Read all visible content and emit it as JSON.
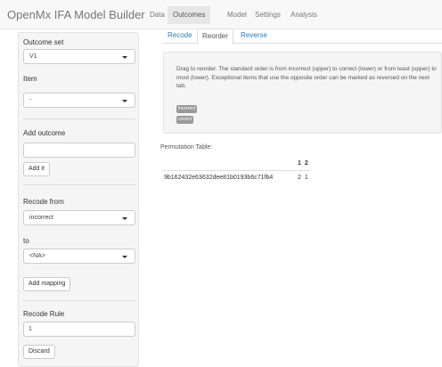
{
  "app": {
    "brand": "OpenMx IFA Model Builder"
  },
  "navbar": {
    "tabs": [
      {
        "label": "Data",
        "active": false
      },
      {
        "label": "Outcomes",
        "active": true
      },
      {
        "label": "Model",
        "active": false
      },
      {
        "label": "Settings",
        "active": false
      },
      {
        "label": "Analysis",
        "active": false
      }
    ]
  },
  "sidebar": {
    "outcome_set": {
      "label": "Outcome set",
      "value": "V1"
    },
    "item": {
      "label": "Item",
      "value": "-"
    },
    "add_outcome": {
      "label": "Add outcome",
      "value": "",
      "button": "Add it"
    },
    "recode_from": {
      "label": "Recode from",
      "value": "incorrect"
    },
    "recode_to": {
      "label": "to",
      "value": "<NA>"
    },
    "add_mapping_button": "Add mapping",
    "recode_rule": {
      "label": "Recode Rule",
      "value": "1",
      "discard_button": "Discard"
    }
  },
  "subtabs": [
    {
      "label": "Recode",
      "active": false
    },
    {
      "label": "Reorder",
      "active": true
    },
    {
      "label": "Reverse",
      "active": false
    }
  ],
  "instructions": {
    "text": "Drag to reorder. The standard order is from incorrect (upper) to correct (lower) or from least (upper) to most (lower). Exceptional items that use the opposite order can be marked as reversed on the next tab.",
    "chips": [
      "incorrect",
      "correct"
    ]
  },
  "permutation": {
    "title": "Permutation Table:",
    "columns": [
      "",
      "1",
      "2"
    ],
    "rows": [
      {
        "name": "9b162432e63632dee81b0193b6c71fb4",
        "values": [
          "2",
          "1"
        ]
      }
    ]
  },
  "colors": {
    "link": "#337ab7",
    "navbar_bg": "#f8f8f8",
    "well_bg": "#f5f5f5",
    "chip_bg": "#999999"
  }
}
